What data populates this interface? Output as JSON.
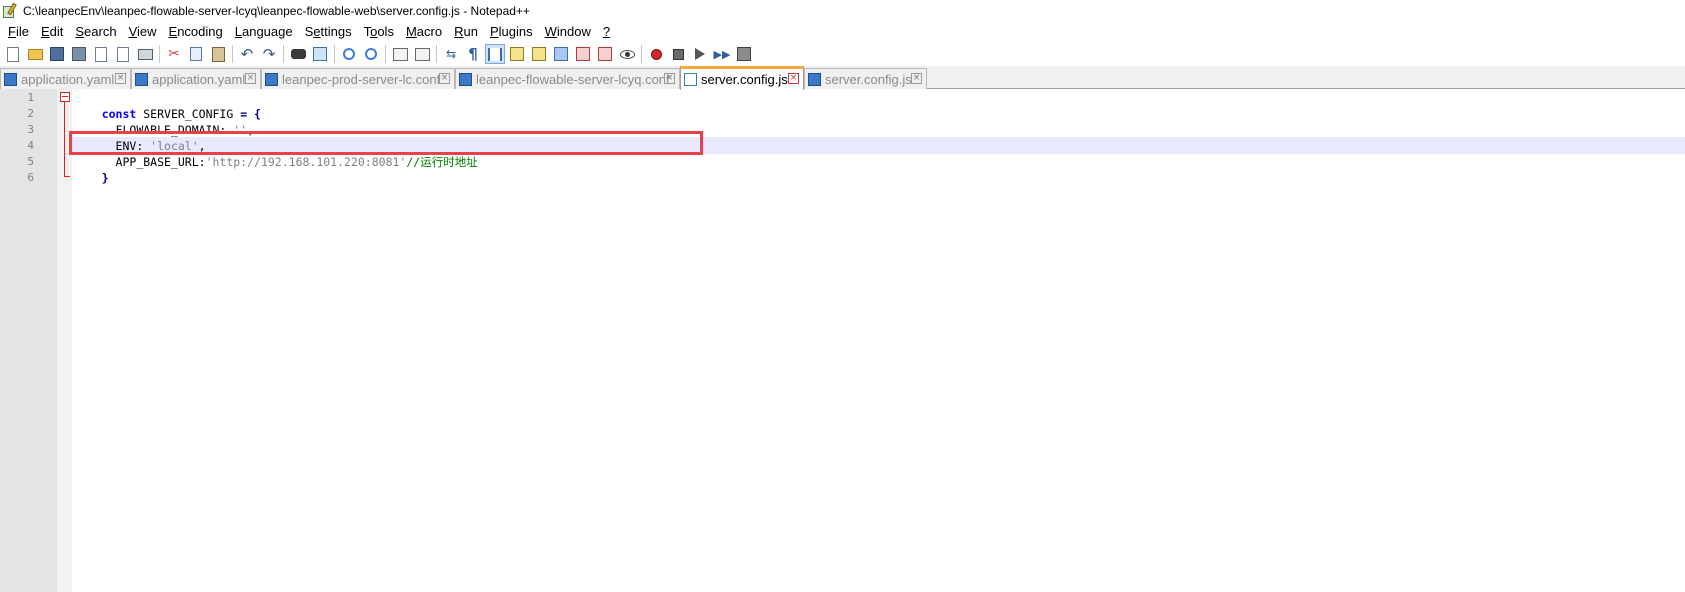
{
  "window": {
    "title": "C:\\leanpecEnv\\leanpec-flowable-server-lcyq\\leanpec-flowable-web\\server.config.js - Notepad++"
  },
  "menu": [
    {
      "u": "F",
      "rest": "ile"
    },
    {
      "u": "E",
      "rest": "dit"
    },
    {
      "u": "S",
      "rest": "earch"
    },
    {
      "u": "V",
      "rest": "iew"
    },
    {
      "u": "E",
      "pre": "",
      "rest": "ncoding"
    },
    {
      "u": "L",
      "rest": "anguage"
    },
    {
      "pre": "S",
      "u": "e",
      "rest": "ttings"
    },
    {
      "pre": "T",
      "u": "o",
      "rest": "ols"
    },
    {
      "u": "M",
      "rest": "acro"
    },
    {
      "u": "R",
      "rest": "un"
    },
    {
      "u": "P",
      "rest": "lugins"
    },
    {
      "u": "W",
      "rest": "indow"
    },
    {
      "u": "?",
      "rest": ""
    }
  ],
  "tabs": [
    {
      "label": "application.yaml",
      "close": "×"
    },
    {
      "label": "application.yaml",
      "close": "×"
    },
    {
      "label": "leanpec-prod-server-lc.conf",
      "close": "×"
    },
    {
      "label": "leanpec-flowable-server-lcyq.conf",
      "close": "×"
    },
    {
      "label": "server.config.js",
      "close": "×",
      "active": true
    },
    {
      "label": "server.config.js",
      "close": "×"
    }
  ],
  "editor": {
    "line_numbers": [
      "1",
      "2",
      "3",
      "4",
      "5",
      "6"
    ],
    "lines": [
      {
        "kw": "const",
        "id": " SERVER_CONFIG ",
        "op": "= {",
        "str": "",
        "cmt": ""
      },
      {
        "kw": "",
        "id": "  FLOWABLE_DOMAIN: ",
        "op": "",
        "str": "''",
        "cmt": ","
      },
      {
        "kw": "",
        "id": "  ENV: ",
        "op": "",
        "str": "'local'",
        "cmt": ","
      },
      {
        "kw": "",
        "id": "  APP_BASE_URL:",
        "op": "",
        "str": "'http://192.168.101.220:8081'",
        "cmt": "//运行时地址"
      },
      {
        "kw": "",
        "id": "",
        "op": "}",
        "str": "",
        "cmt": ""
      },
      {
        "kw": "",
        "id": "",
        "op": "",
        "str": "",
        "cmt": ""
      }
    ],
    "current_line": "4"
  },
  "colors": {
    "keyword": "#0000ff",
    "string": "#808080",
    "comment": "#008000",
    "highlight_box": "#e8414a",
    "active_tab_accent": "#f6a83b"
  }
}
